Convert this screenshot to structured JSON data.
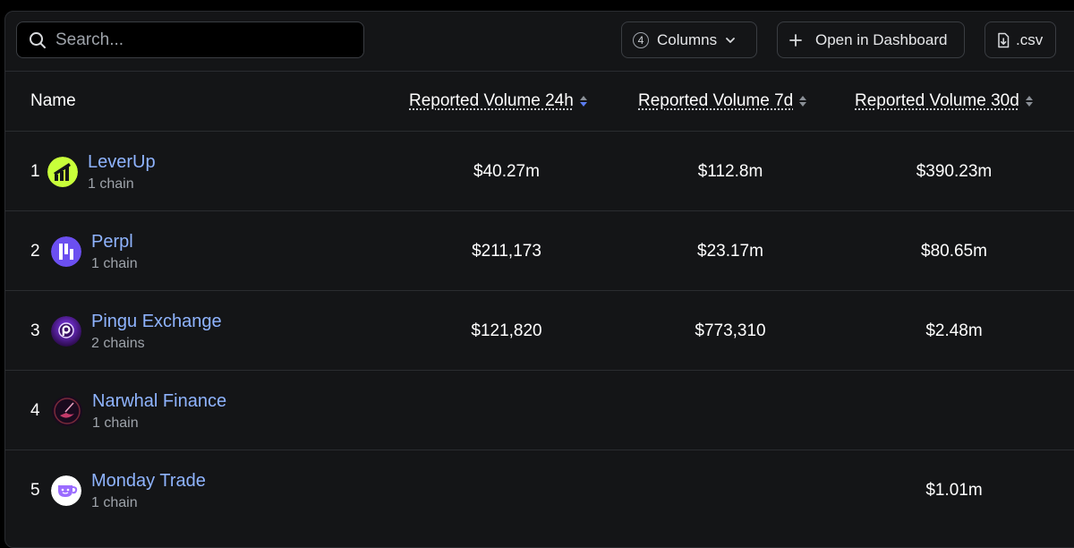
{
  "toolbar": {
    "search_placeholder": "Search...",
    "columns_count": "4",
    "columns_label": "Columns",
    "dashboard_label": "Open in Dashboard",
    "csv_label": ".csv"
  },
  "table": {
    "headers": {
      "name": "Name",
      "vol24": "Reported Volume 24h",
      "vol7": "Reported Volume 7d",
      "vol30": "Reported Volume 30d"
    },
    "rows": [
      {
        "rank": "1",
        "name": "LeverUp",
        "chains": "1 chain",
        "vol24": "$40.27m",
        "vol7": "$112.8m",
        "vol30": "$390.23m",
        "logo": "leverup-logo",
        "logo_color": "#c8ff3a"
      },
      {
        "rank": "2",
        "name": "Perpl",
        "chains": "1 chain",
        "vol24": "$211,173",
        "vol7": "$23.17m",
        "vol30": "$80.65m",
        "logo": "perpl-logo",
        "logo_color": "#6b4ff0"
      },
      {
        "rank": "3",
        "name": "Pingu Exchange",
        "chains": "2 chains",
        "vol24": "$121,820",
        "vol7": "$773,310",
        "vol30": "$2.48m",
        "logo": "pingu-logo",
        "logo_color": "#4a1a7a"
      },
      {
        "rank": "4",
        "name": "Narwhal Finance",
        "chains": "1 chain",
        "vol24": "",
        "vol7": "",
        "vol30": "",
        "logo": "narwhal-logo",
        "logo_color": "#2a1030"
      },
      {
        "rank": "5",
        "name": "Monday Trade",
        "chains": "1 chain",
        "vol24": "",
        "vol7": "",
        "vol30": "$1.01m",
        "logo": "monday-trade-logo",
        "logo_color": "#9b6cff"
      }
    ]
  },
  "colors": {
    "panel_bg": "#141517",
    "link": "#8fb4ff",
    "sort_active": "#5b7cf0"
  }
}
